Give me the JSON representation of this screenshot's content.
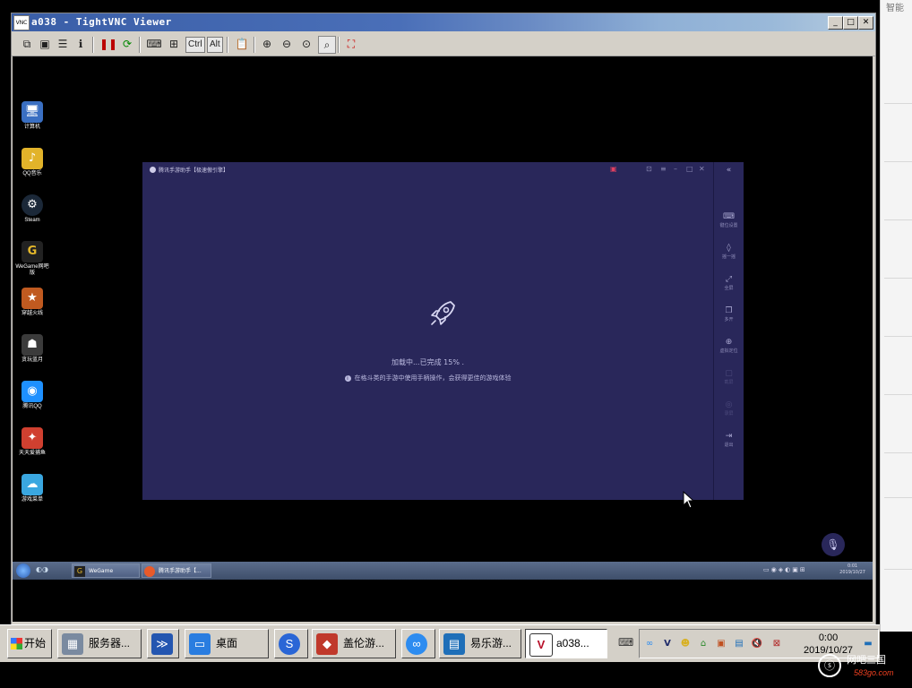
{
  "outer": {
    "right_text": "智能"
  },
  "vnc": {
    "title": "a038 - TightVNC Viewer",
    "title_icon": "VNC",
    "toolbar": {
      "ctrl": "Ctrl",
      "alt": "Alt"
    }
  },
  "remote_desktop": {
    "icons": [
      {
        "label": "计算机",
        "icon": "computer-icon",
        "color": "#3a6fc2",
        "glyph": "🖥"
      },
      {
        "label": "QQ音乐",
        "icon": "qq-music-icon",
        "color": "#e2b32a",
        "glyph": "♪"
      },
      {
        "label": "Steam",
        "icon": "steam-icon",
        "color": "#1b2838",
        "glyph": "⚙"
      },
      {
        "label": "WeGame网吧版",
        "icon": "wegame-icon",
        "color": "#222",
        "glyph": "G"
      },
      {
        "label": "穿越火线",
        "icon": "game-icon",
        "color": "#c05a20",
        "glyph": "★"
      },
      {
        "label": "贪玩蓝月",
        "icon": "game-icon-2",
        "color": "#3b3b3b",
        "glyph": "☗"
      },
      {
        "label": "腾讯QQ",
        "icon": "qq-icon",
        "color": "#1e90ff",
        "glyph": "◉"
      },
      {
        "label": "天天爱捕鱼",
        "icon": "fishing-game-icon",
        "color": "#d04030",
        "glyph": "✦"
      },
      {
        "label": "游戏菜单",
        "icon": "game-menu-icon",
        "color": "#3aa7e0",
        "glyph": "☁"
      }
    ]
  },
  "emulator": {
    "title": "腾讯手游助手【极速傲引擎】",
    "loading_text": "加载中...已完成 15% .",
    "tip_text": "在格斗类的手游中使用手柄操作，会获得更佳的游戏体验",
    "side_items": [
      {
        "label": "键位设置",
        "glyph": "⌨",
        "enabled": true
      },
      {
        "label": "摇一摇",
        "glyph": "◊",
        "enabled": true
      },
      {
        "label": "全屏",
        "glyph": "⤢",
        "enabled": true
      },
      {
        "label": "多开",
        "glyph": "❐",
        "enabled": true
      },
      {
        "label": "虚拟定位",
        "glyph": "⊕",
        "enabled": true
      },
      {
        "label": "截屏",
        "glyph": "▢",
        "enabled": false
      },
      {
        "label": "录屏",
        "glyph": "◎",
        "enabled": false
      },
      {
        "label": "退出",
        "glyph": "⇥",
        "enabled": true
      }
    ]
  },
  "remote_taskbar": {
    "items": [
      {
        "label": "WeGame"
      },
      {
        "label": "腾讯手游助手【..."
      }
    ],
    "time": "0:01",
    "date": "2019/10/27"
  },
  "host_taskbar": {
    "start": "开始",
    "buttons": [
      {
        "label": "服务器...",
        "icon": "server-icon",
        "color": "#7a8aa0",
        "glyph": "▦"
      },
      {
        "label": "",
        "icon": "powershell-icon",
        "color": "#2456b0",
        "glyph": "≫"
      },
      {
        "label": "桌面",
        "icon": "desktop-icon",
        "color": "#2a7de0",
        "glyph": "▭"
      },
      {
        "label": "",
        "icon": "sogou-icon",
        "color": "#2a66d6",
        "glyph": "S"
      },
      {
        "label": "盖伦游...",
        "icon": "garena-icon",
        "color": "#c0392b",
        "glyph": "◆"
      },
      {
        "label": "",
        "icon": "baidu-netdisk-icon",
        "color": "#2d8cf0",
        "glyph": "∞"
      },
      {
        "label": "易乐游...",
        "icon": "yileyou-icon",
        "color": "#1f6fb8",
        "glyph": "▤"
      },
      {
        "label": "a038...",
        "icon": "vnc-icon",
        "color": "#b8102a",
        "glyph": "V"
      }
    ],
    "time": "0:00",
    "date": "2019/10/27"
  },
  "watermark": {
    "text": "网吧三国",
    "url": "583go.com"
  }
}
